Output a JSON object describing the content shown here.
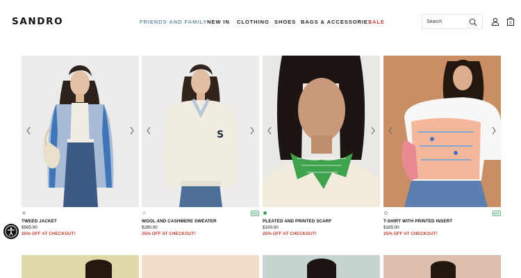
{
  "brand": {
    "logo_text": "SANDRO"
  },
  "nav": {
    "friends_family": "FRIENDS AND FAMILY",
    "new_in": "NEW IN",
    "clothing": "CLOTHING",
    "shoes": "SHOES",
    "bags": "BAGS & ACCESSORIES",
    "sale": "SALE"
  },
  "search": {
    "placeholder": "Search"
  },
  "icons": {
    "search": "search-icon",
    "account": "user-icon",
    "bag": "shopping-bag-icon",
    "accessibility": "accessibility-icon",
    "eco": "eco-label-icon"
  },
  "cart": {
    "count": "0"
  },
  "colors": {
    "nav_highlight": "#6a8fa8",
    "sale": "#c03b33",
    "promo": "#c0392b",
    "eco_green": "#2f9e5b"
  },
  "products": [
    {
      "name": "TWEED JACKET",
      "price": "$565.00",
      "promo": "25% OFF AT CHECKOUT!",
      "swatch": "#b7c3d4",
      "eco": false
    },
    {
      "name": "WOOL AND CASHMERE SWEATER",
      "price": "$280.00",
      "promo": "25% OFF AT CHECKOUT!",
      "swatch": "#efece4",
      "eco": true
    },
    {
      "name": "PLEATED AND PRINTED SCARF",
      "price": "$100.00",
      "promo": "25% OFF AT CHECKOUT!",
      "swatch": "#3aa34a",
      "eco": false
    },
    {
      "name": "T-SHIRT WITH PRINTED INSERT",
      "price": "$165.00",
      "promo": "25% OFF AT CHECKOUT!",
      "swatch": "#ffffff",
      "eco": true
    }
  ]
}
